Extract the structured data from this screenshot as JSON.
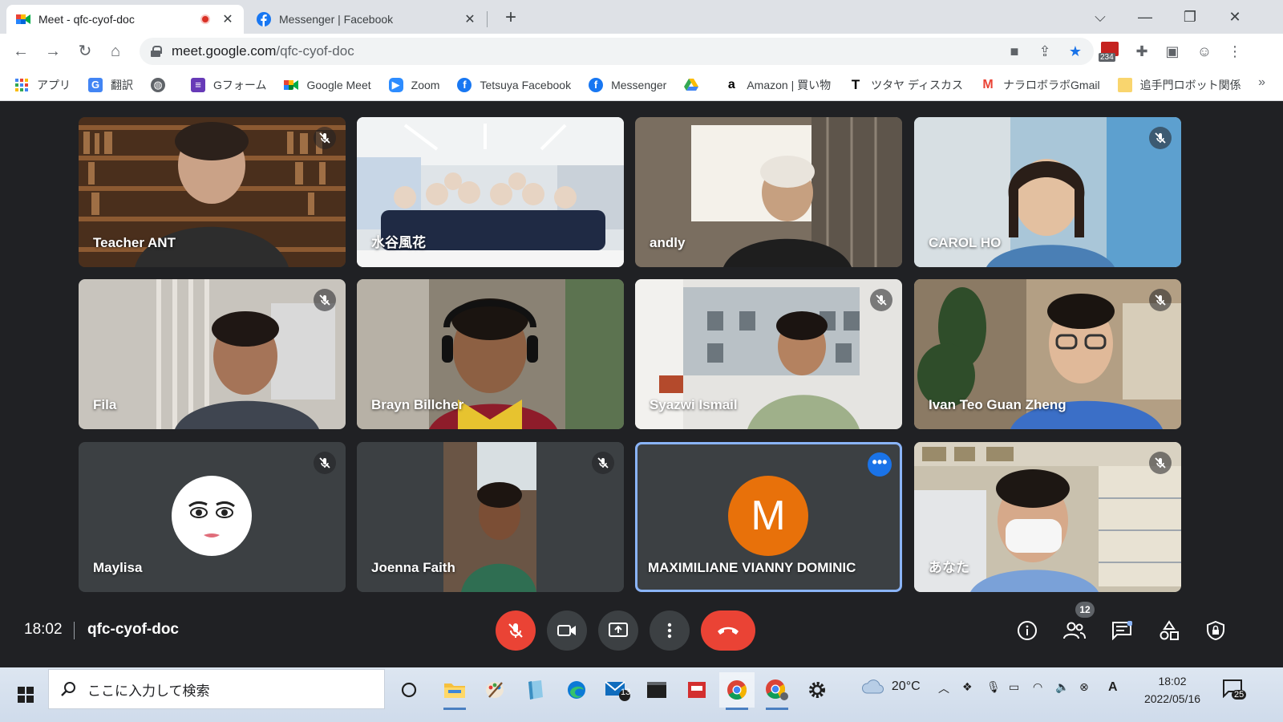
{
  "browser": {
    "tabs": [
      {
        "title": "Meet - qfc-cyof-doc",
        "icon": "google-meet-icon",
        "active": true,
        "recording": true
      },
      {
        "title": "Messenger | Facebook",
        "icon": "facebook-icon",
        "active": false
      }
    ],
    "url_host": "meet.google.com",
    "url_path": "/qfc-cyof-doc",
    "extension_badge": "234",
    "bookmarks": [
      {
        "label": "アプリ",
        "icon": "apps-grid-icon"
      },
      {
        "label": "翻訳",
        "icon": "google-translate-icon"
      },
      {
        "label": "",
        "icon": "globe-icon"
      },
      {
        "label": "Gフォーム",
        "icon": "google-forms-icon"
      },
      {
        "label": "Google Meet",
        "icon": "google-meet-icon"
      },
      {
        "label": "Zoom",
        "icon": "zoom-icon"
      },
      {
        "label": "Tetsuya Facebook",
        "icon": "facebook-icon"
      },
      {
        "label": "Messenger",
        "icon": "facebook-icon"
      },
      {
        "label": "",
        "icon": "google-drive-icon"
      },
      {
        "label": "Amazon | 買い物",
        "icon": "amazon-icon"
      },
      {
        "label": "ツタヤ ディスカス",
        "icon": "tsutaya-icon"
      },
      {
        "label": "ナラロボラボGmail",
        "icon": "gmail-icon"
      },
      {
        "label": "追手門ロボット関係",
        "icon": "folder-icon"
      }
    ],
    "bookmarks_overflow": "»"
  },
  "meet": {
    "participants": [
      {
        "name": "Teacher ANT",
        "muted": true
      },
      {
        "name": "水谷風花",
        "muted": false
      },
      {
        "name": "andly",
        "muted": false
      },
      {
        "name": "CAROL HO",
        "muted": true
      },
      {
        "name": "Fila",
        "muted": true
      },
      {
        "name": "Brayn Billcher",
        "muted": false
      },
      {
        "name": "Syazwi Ismail",
        "muted": true
      },
      {
        "name": "Ivan Teo Guan Zheng",
        "muted": true
      },
      {
        "name": "Maylisa",
        "muted": true
      },
      {
        "name": "Joenna Faith",
        "muted": true
      },
      {
        "name": "MAXIMILIANE VIANNY DOMINIC",
        "muted": false,
        "avatar_letter": "M",
        "avatar_color": "#e8710a"
      },
      {
        "name": "あなた",
        "muted": true
      }
    ],
    "time": "18:02",
    "meeting_code": "qfc-cyof-doc",
    "people_count": "12",
    "colors": {
      "danger": "#ea4335",
      "accent": "#1a73e8",
      "background": "#202124"
    }
  },
  "taskbar": {
    "search_placeholder": "ここに入力して検索",
    "mail_badge": "13",
    "weather": "20°C",
    "clock_time": "18:02",
    "clock_date": "2022/05/16",
    "notification_count": "25",
    "ime_indicator": "A"
  }
}
